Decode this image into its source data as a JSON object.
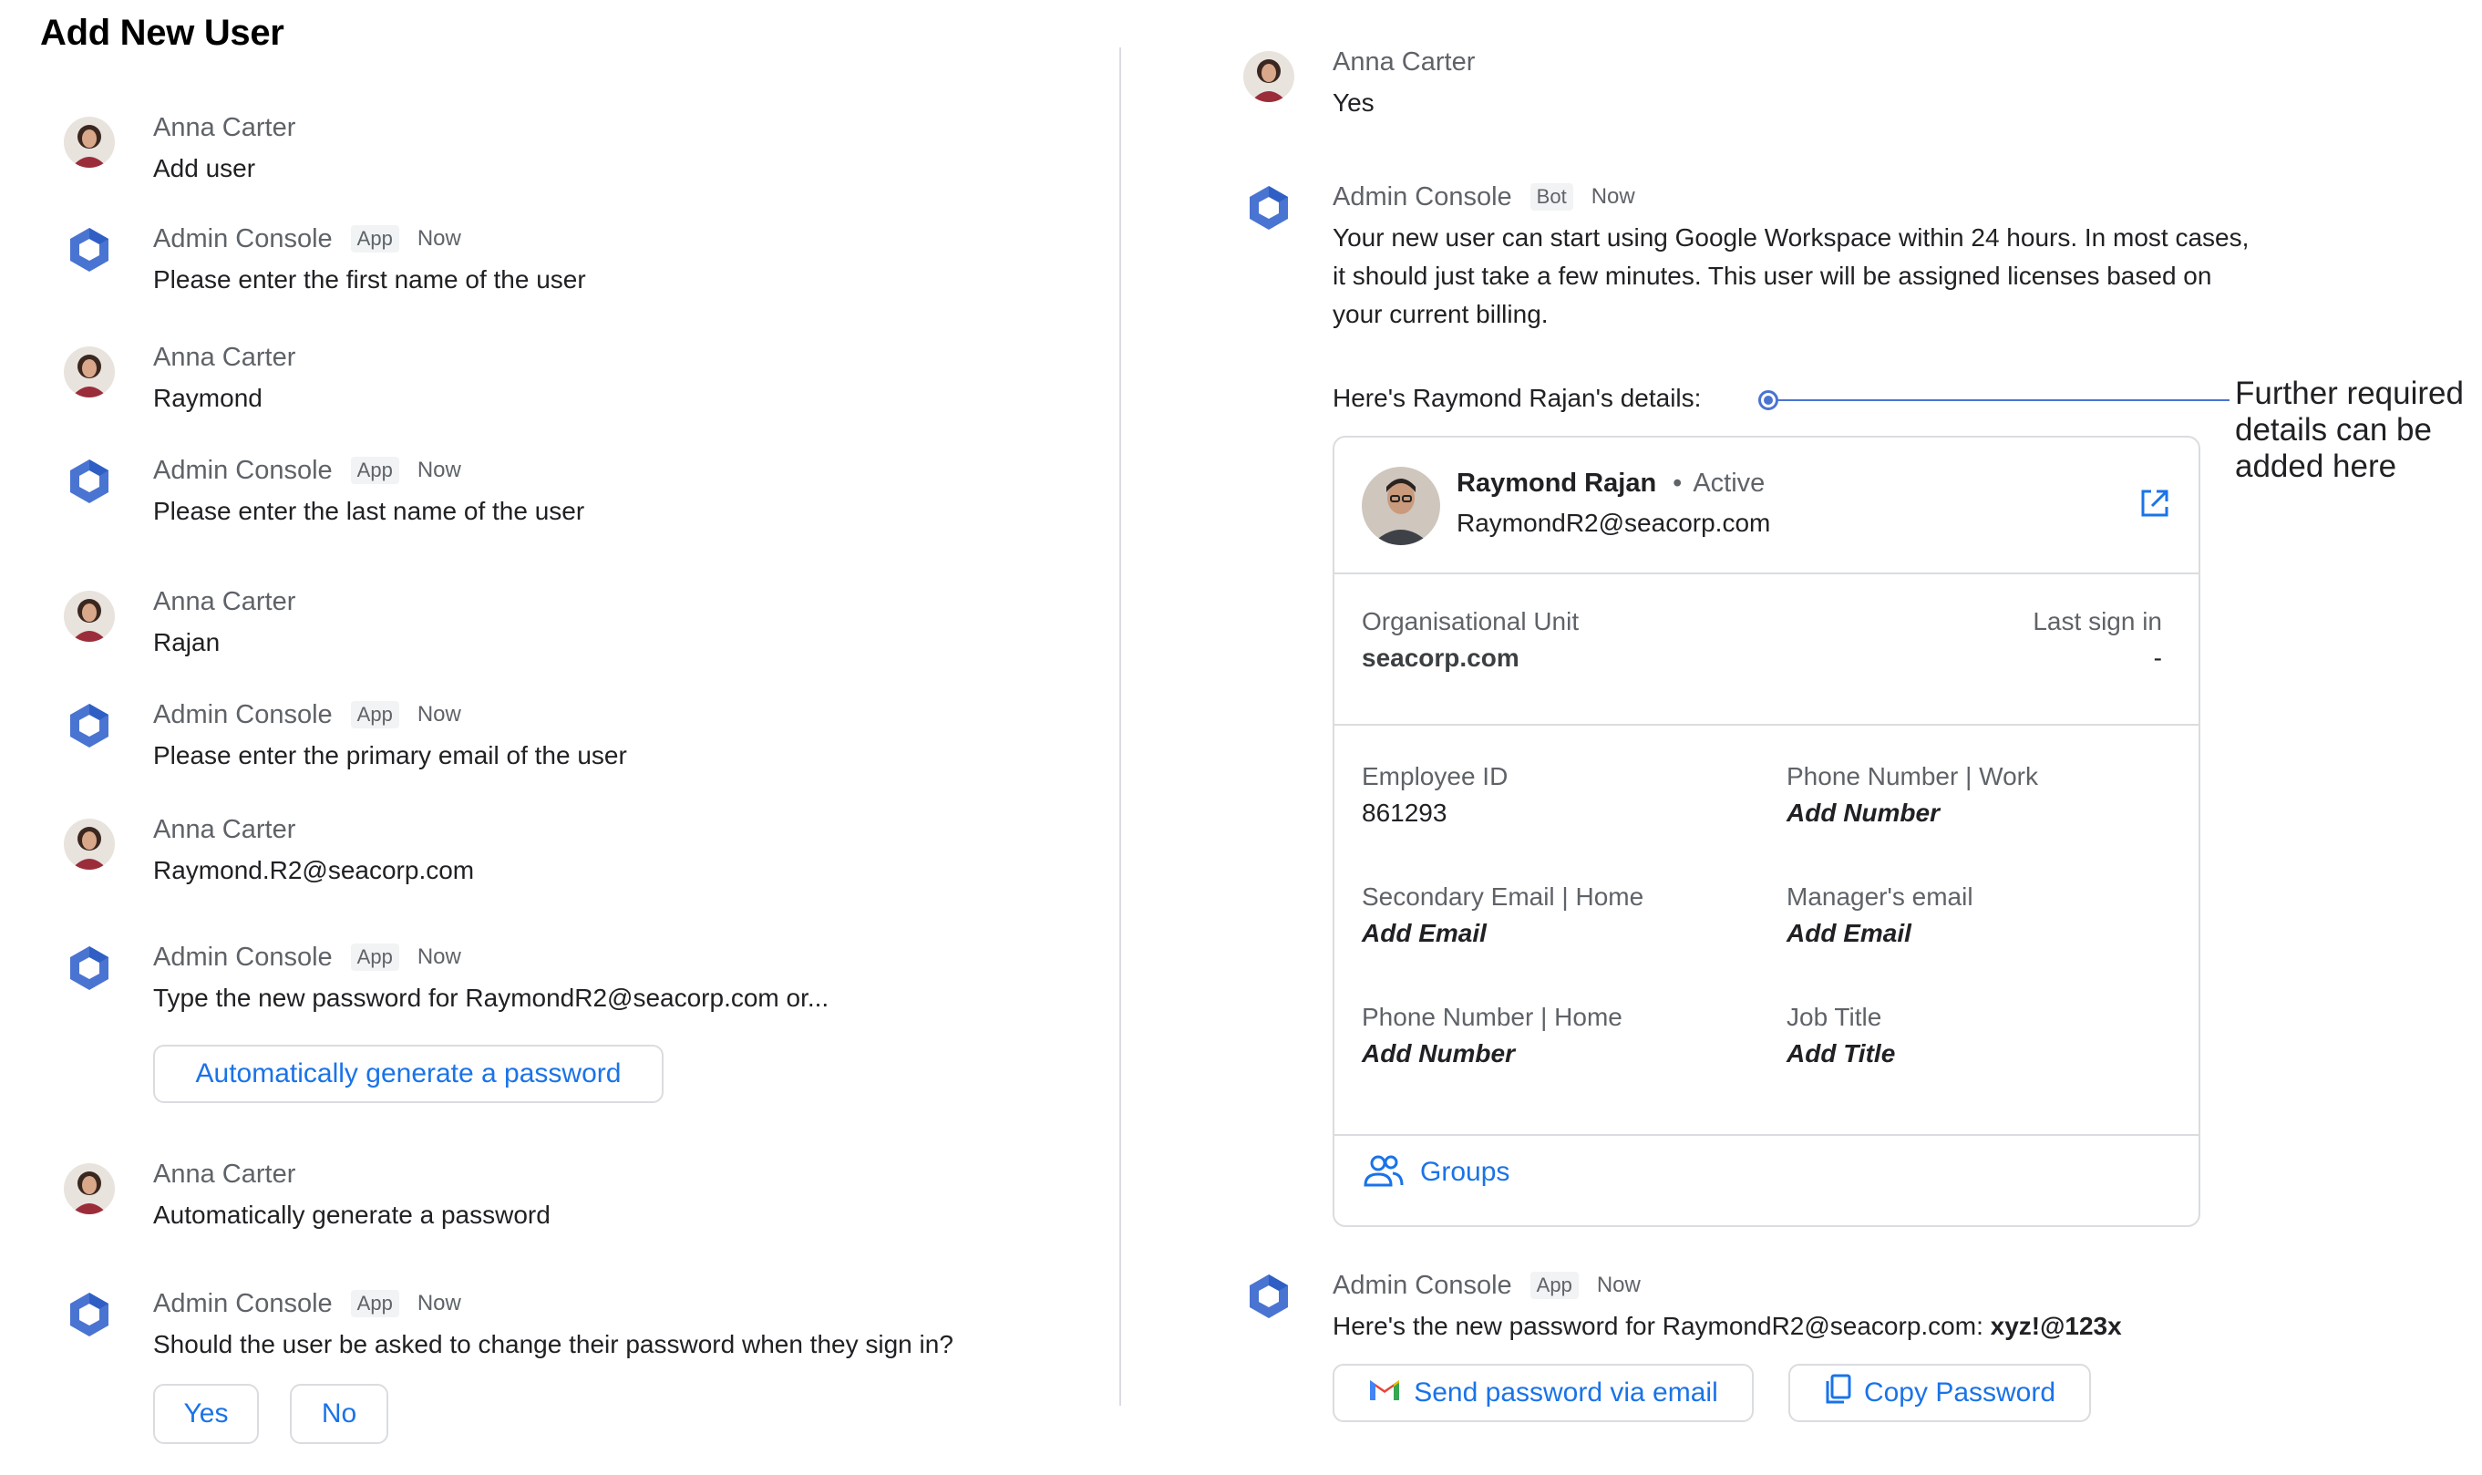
{
  "page": {
    "title": "Add New User"
  },
  "left_messages": [
    {
      "sender": "Anna Carter",
      "text": "Add user"
    },
    {
      "sender": "Admin Console",
      "tag": "App",
      "time": "Now",
      "text": "Please enter the first name of the user"
    },
    {
      "sender": "Anna Carter",
      "text": "Raymond"
    },
    {
      "sender": "Admin Console",
      "tag": "App",
      "time": "Now",
      "text": "Please enter the last name of the user"
    },
    {
      "sender": "Anna Carter",
      "text": "Rajan"
    },
    {
      "sender": "Admin Console",
      "tag": "App",
      "time": "Now",
      "text": "Please enter the primary email of the user"
    },
    {
      "sender": "Anna Carter",
      "text": "Raymond.R2@seacorp.com"
    },
    {
      "sender": "Admin Console",
      "tag": "App",
      "time": "Now",
      "text": "Type the new password for RaymondR2@seacorp.com or...",
      "button": "Automatically generate a password"
    },
    {
      "sender": "Anna Carter",
      "text": "Automatically generate a password"
    },
    {
      "sender": "Admin Console",
      "tag": "App",
      "time": "Now",
      "text": "Should the user be asked to change their password when they sign in?",
      "buttons": [
        "Yes",
        "No"
      ]
    }
  ],
  "right_messages": {
    "reply": {
      "sender": "Anna Carter",
      "text": "Yes"
    },
    "bot": {
      "sender": "Admin Console",
      "tag": "Bot",
      "time": "Now",
      "lines": [
        "Your new user can start using Google Workspace within 24 hours. In most cases,",
        "it should just take a few minutes. This user will be assigned licenses based on",
        "your current billing."
      ],
      "details_label": "Here's Raymond Rajan's details:"
    },
    "final": {
      "sender": "Admin Console",
      "tag": "App",
      "time": "Now",
      "text_prefix": "Here's the new password for RaymondR2@seacorp.com:",
      "password": "xyz!@123x",
      "send_button": "Send password via email",
      "copy_button": "Copy Password"
    }
  },
  "callout": {
    "lines": [
      "Further required",
      "details can be",
      "added here"
    ]
  },
  "card": {
    "name": "Raymond Rajan",
    "separator": "•",
    "status": "Active",
    "email": "RaymondR2@seacorp.com",
    "org_unit_label": "Organisational Unit",
    "org_unit_value": "seacorp.com",
    "last_sign_in_label": "Last sign in",
    "last_sign_in_value": "-",
    "fields": [
      {
        "label": "Employee ID",
        "value": "861293"
      },
      {
        "label": "Phone Number | Work",
        "value": "Add Number"
      },
      {
        "label": "Secondary Email | Home",
        "value": "Add Email"
      },
      {
        "label": "Manager's email",
        "value": "Add Email"
      },
      {
        "label": "Phone Number | Home",
        "value": "Add Number"
      },
      {
        "label": "Job Title",
        "value": "Add Title"
      }
    ],
    "groups_label": "Groups"
  },
  "colors": {
    "accent": "#1a73e8",
    "bot_icon": "#4a74d1",
    "divider": "#dadce0",
    "muted_text": "#5f6368"
  },
  "icons": {
    "user_avatar": "anna-carter-avatar",
    "bot": "admin-console-hexagon-icon",
    "external": "open-external-icon",
    "groups": "groups-icon",
    "gmail": "gmail-icon",
    "copy": "copy-icon"
  }
}
